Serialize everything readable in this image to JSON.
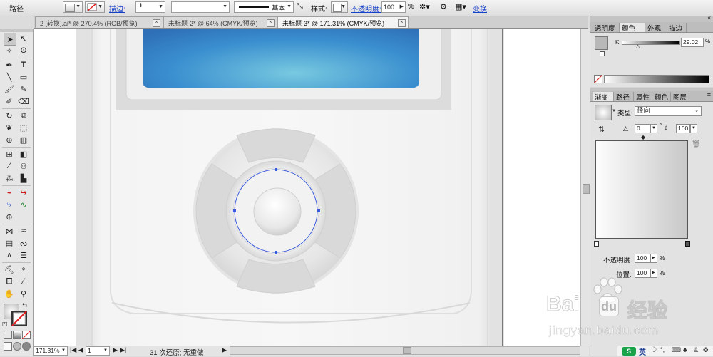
{
  "control_bar": {
    "object_type": "路径",
    "stroke_label": "描边:",
    "stroke_profile": "基本",
    "style_label": "样式:",
    "opacity_label": "不透明度:",
    "opacity_value": "100",
    "opacity_unit": "%",
    "transform_label": "变换"
  },
  "tabs": [
    {
      "label": "2 [转换].ai* @ 270.4% (RGB/预览)"
    },
    {
      "label": "未标题-2* @ 64% (CMYK/预览)"
    },
    {
      "label": "未标题-3* @ 171.31% (CMYK/预览)"
    }
  ],
  "panels": {
    "top_tabs": [
      "透明度",
      "颜色",
      "外观",
      "描边"
    ],
    "color": {
      "channel": "K",
      "value": "29.02",
      "unit": "%"
    },
    "gradient_tabs": [
      "渐变",
      "路径",
      "属性",
      "颜色",
      "图层"
    ],
    "gradient": {
      "type_label": "类型:",
      "type_value": "径向",
      "angle_value": "0",
      "angle_unit": "°",
      "aspect_value": "100",
      "opacity_label": "不透明度:",
      "opacity_value": "100",
      "opacity_unit": "%",
      "location_label": "位置:",
      "location_value": "100",
      "location_unit": "%"
    }
  },
  "status_bar": {
    "zoom": "171.31%",
    "artboard": "1",
    "history": "31 次还原; 无重做"
  },
  "watermark": {
    "brand_left": "Bai",
    "brand_right": "经验",
    "url": "jingyan.baidu.com"
  },
  "ime": {
    "label": "英"
  },
  "colors": {
    "screen_blue": "#3a8fcf",
    "selection_blue": "#3b5bdb",
    "link_blue": "#1540c8",
    "device_gray": "#d9d9d9"
  }
}
